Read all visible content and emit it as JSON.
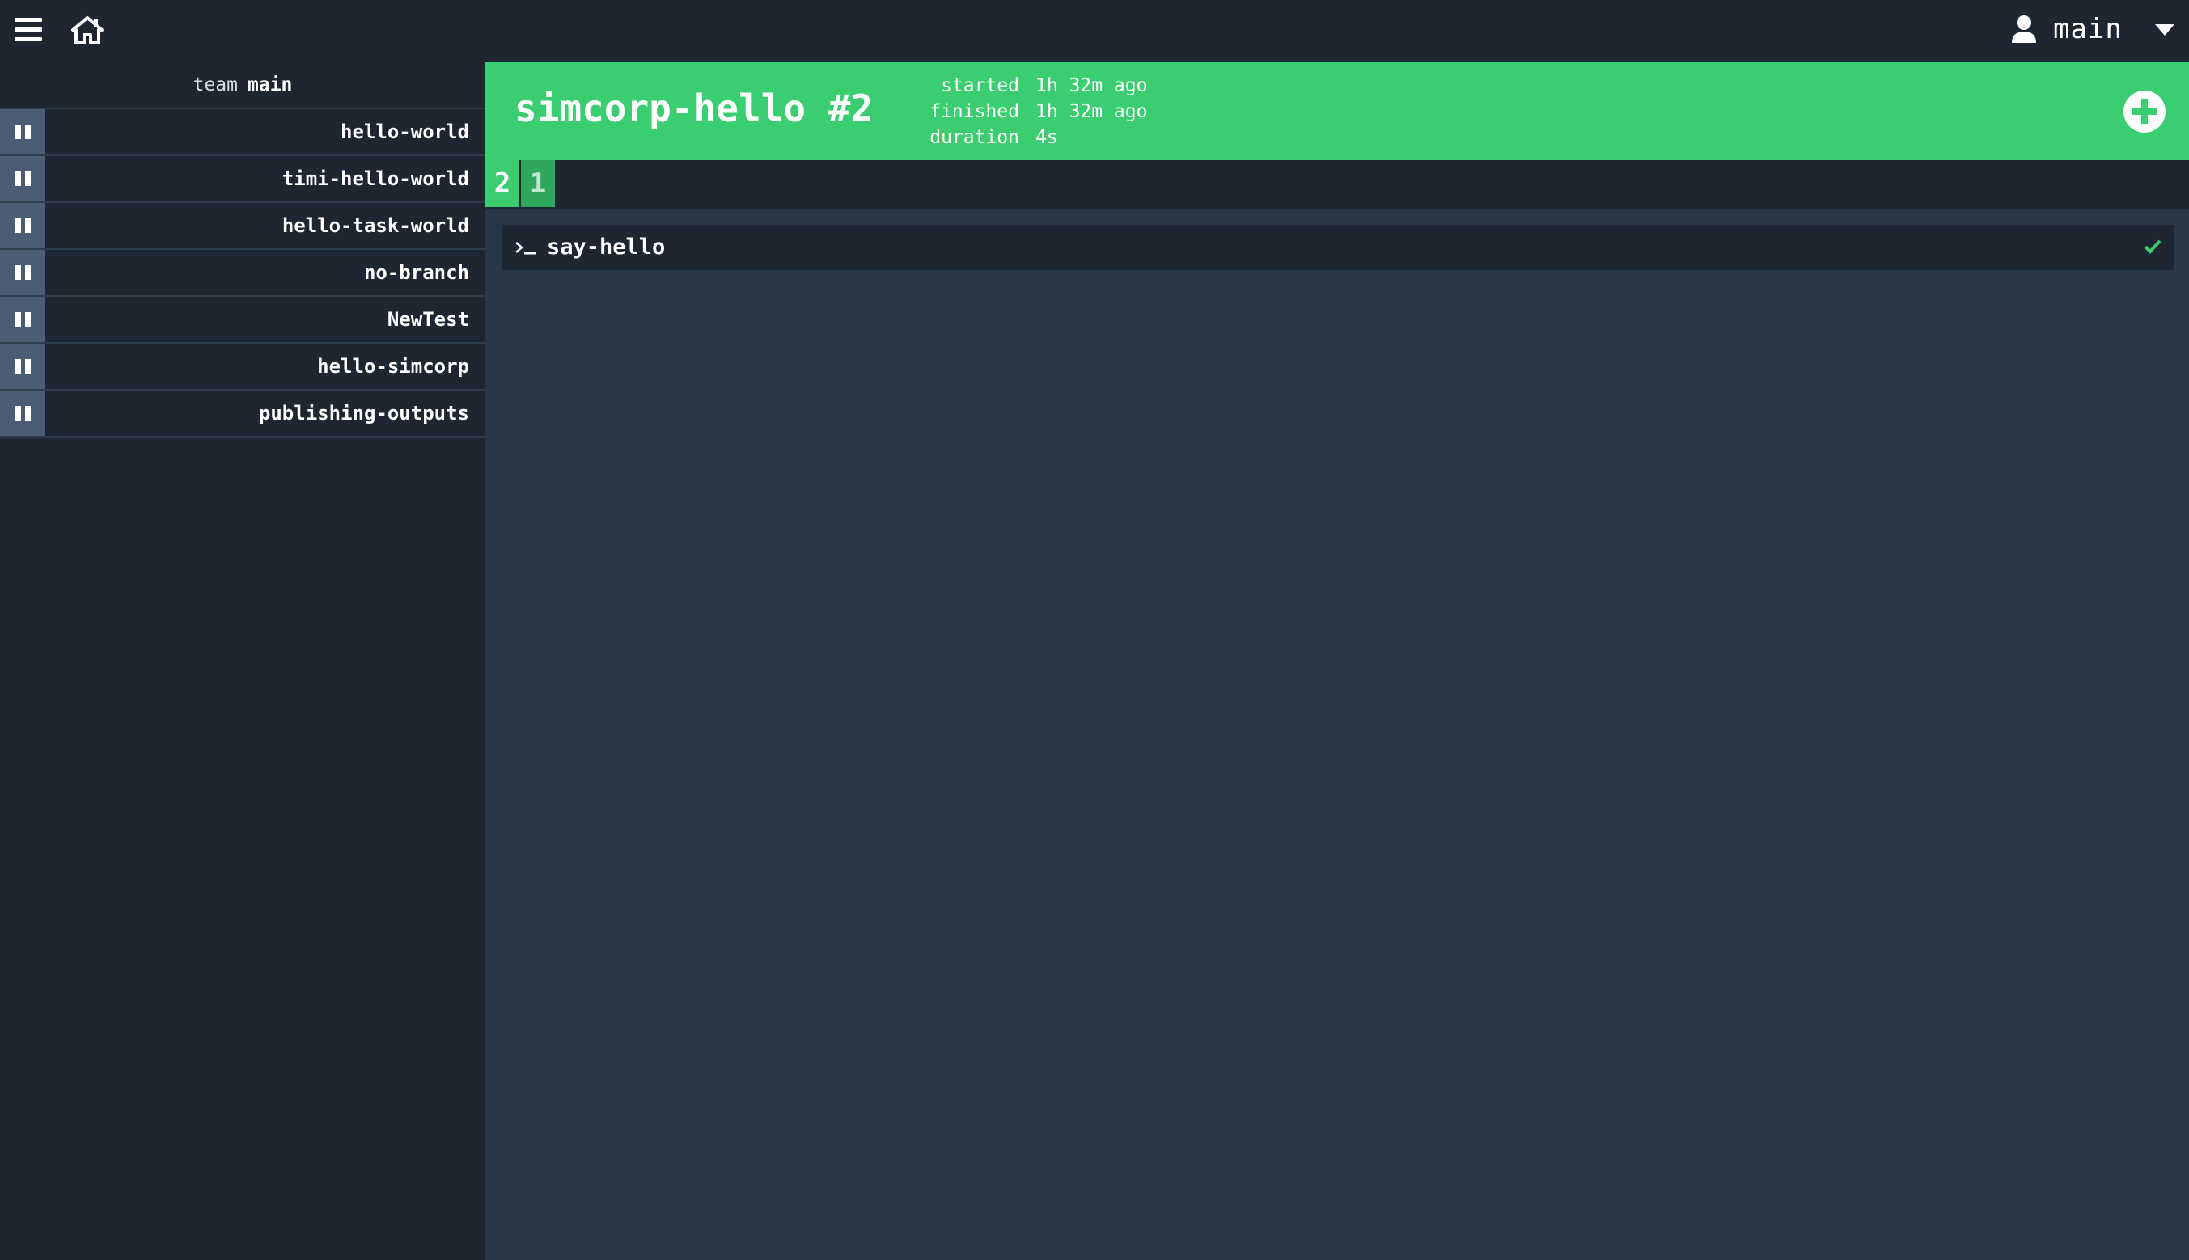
{
  "topbar": {
    "menu_icon": "hamburger-icon",
    "home_icon": "home-icon",
    "user": {
      "icon": "user-icon",
      "name": "main",
      "dropdown_icon": "caret-down-icon"
    }
  },
  "sidebar": {
    "team_label": "team",
    "team_name": "main",
    "pipelines": [
      {
        "name": "hello-world"
      },
      {
        "name": "timi-hello-world"
      },
      {
        "name": "hello-task-world"
      },
      {
        "name": "no-branch"
      },
      {
        "name": "NewTest"
      },
      {
        "name": "hello-simcorp"
      },
      {
        "name": "publishing-outputs"
      }
    ]
  },
  "build": {
    "title": "simcorp-hello #2",
    "status_color": "#3ace71",
    "meta": [
      {
        "label": "started",
        "value": "1h 32m ago"
      },
      {
        "label": "finished",
        "value": "1h 32m ago"
      },
      {
        "label": "duration",
        "value": "4s"
      }
    ],
    "add_icon": "plus-circle-icon",
    "tabs": [
      {
        "label": "2",
        "current": true
      },
      {
        "label": "1",
        "current": false
      }
    ]
  },
  "tasks": [
    {
      "icon": "terminal-icon",
      "name": "say-hello",
      "status_icon": "check-icon",
      "status_color": "#3ace71"
    }
  ],
  "colors": {
    "topbar": "#1e2631",
    "sidebar": "#1e2631",
    "main_bg": "#273747",
    "pause_button": "#4a5d75",
    "success": "#3ace71"
  }
}
